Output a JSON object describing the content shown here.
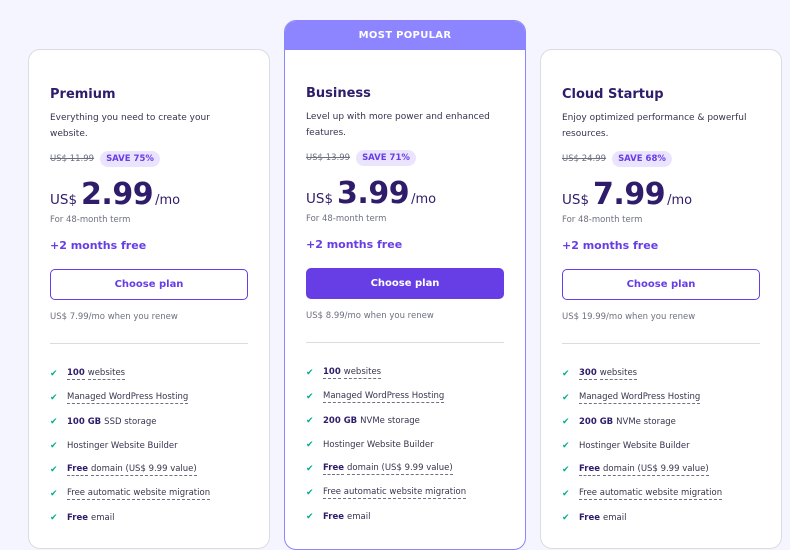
{
  "plans": [
    {
      "name": "Premium",
      "description": "Everything you need to create your website.",
      "old_price": "US$ 11.99",
      "save_badge": "SAVE 75%",
      "currency": "US$",
      "price": "2.99",
      "per": "/mo",
      "term": "For 48-month term",
      "free_months": "+2 months free",
      "button_label": "Choose plan",
      "renew_text": "US$ 7.99/mo when you renew",
      "features": [
        {
          "strong": "100",
          "text": "websites"
        },
        {
          "strong": "",
          "text": "Managed WordPress Hosting"
        },
        {
          "strong": "100 GB",
          "text": "SSD storage"
        },
        {
          "strong": "",
          "text": "Hostinger Website Builder"
        },
        {
          "strong": "Free",
          "text": "domain (US$ 9.99 value)"
        },
        {
          "strong": "",
          "text": "Free automatic website migration"
        },
        {
          "strong": "Free",
          "text": "email"
        }
      ]
    },
    {
      "banner": "MOST POPULAR",
      "name": "Business",
      "description": "Level up with more power and enhanced features.",
      "old_price": "US$ 13.99",
      "save_badge": "SAVE 71%",
      "currency": "US$",
      "price": "3.99",
      "per": "/mo",
      "term": "For 48-month term",
      "free_months": "+2 months free",
      "button_label": "Choose plan",
      "renew_text": "US$ 8.99/mo when you renew",
      "features": [
        {
          "strong": "100",
          "text": "websites"
        },
        {
          "strong": "",
          "text": "Managed WordPress Hosting"
        },
        {
          "strong": "200 GB",
          "text": "NVMe storage"
        },
        {
          "strong": "",
          "text": "Hostinger Website Builder"
        },
        {
          "strong": "Free",
          "text": "domain (US$ 9.99 value)"
        },
        {
          "strong": "",
          "text": "Free automatic website migration"
        },
        {
          "strong": "Free",
          "text": "email"
        }
      ]
    },
    {
      "name": "Cloud Startup",
      "description": "Enjoy optimized performance & powerful resources.",
      "old_price": "US$ 24.99",
      "save_badge": "SAVE 68%",
      "currency": "US$",
      "price": "7.99",
      "per": "/mo",
      "term": "For 48-month term",
      "free_months": "+2 months free",
      "button_label": "Choose plan",
      "renew_text": "US$ 19.99/mo when you renew",
      "features": [
        {
          "strong": "300",
          "text": "websites"
        },
        {
          "strong": "",
          "text": "Managed WordPress Hosting"
        },
        {
          "strong": "200 GB",
          "text": "NVMe storage"
        },
        {
          "strong": "",
          "text": "Hostinger Website Builder"
        },
        {
          "strong": "Free",
          "text": "domain (US$ 9.99 value)"
        },
        {
          "strong": "",
          "text": "Free automatic website migration"
        },
        {
          "strong": "Free",
          "text": "email"
        }
      ]
    }
  ],
  "icons": {
    "feature_check": "check-icon"
  },
  "colors": {
    "accent": "#673de6",
    "banner": "#8c85ff",
    "check": "#00b090",
    "heading": "#2f1c6a"
  }
}
